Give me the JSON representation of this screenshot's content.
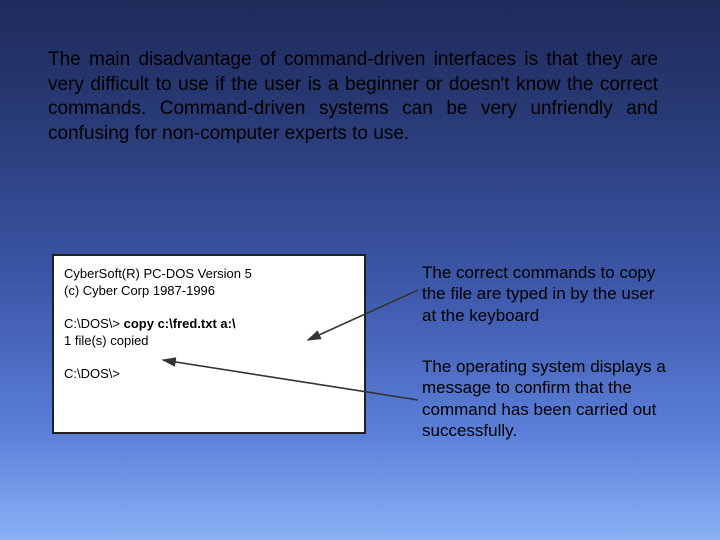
{
  "paragraph": "The main disadvantage of command-driven interfaces is that they are very difficult to use if the user is a beginner or doesn't know the correct commands. Command-driven systems can be very unfriendly and confusing for non-computer experts to use.",
  "terminal": {
    "line1": "CyberSoft(R)  PC-DOS Version 5",
    "line2": "(c) Cyber Corp 1987-1996",
    "prompt1_prefix": "C:\\DOS\\> ",
    "prompt1_cmd": "copy c:\\fred.txt  a:\\",
    "line_response": "1 file(s) copied",
    "prompt2": "C:\\DOS\\>"
  },
  "captions": {
    "cmd": "The correct commands to copy the file are typed in by the user at the keyboard",
    "response": "The operating system displays a message to confirm that the command has been carried out successfully."
  }
}
